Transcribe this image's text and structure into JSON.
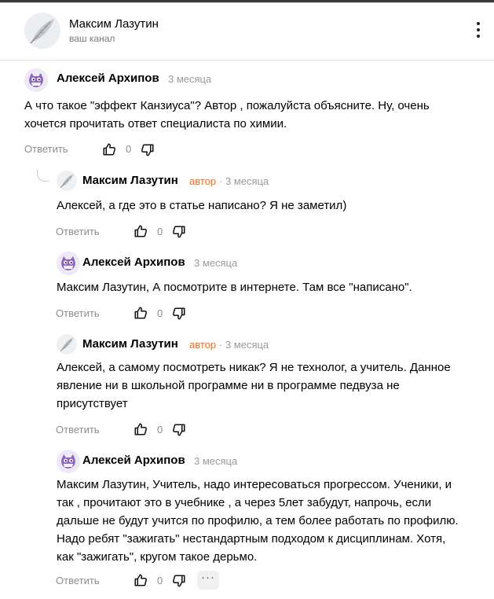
{
  "channel": {
    "name": "Максим Лазутин",
    "subtitle": "ваш канал",
    "avatar_icon": "feather-icon"
  },
  "comments": [
    {
      "author": "Алексей Архипов",
      "date": "3 месяца",
      "text_lines": [
        "А что такое \"эффект Канзиуса\"? Автор , пожалуйста объясните. Ну, очень",
        "хочется прочитать ответ специалиста по химии."
      ],
      "reply_label": "Ответить",
      "likes": "0",
      "avatar_icon": "mascot-avatar-icon"
    },
    {
      "author": "Максим Лазутин",
      "badge": "автор",
      "date": "· 3 месяца",
      "text_lines": [
        "Алексей, а где это в статье написано? Я не заметил)"
      ],
      "reply_label": "Ответить",
      "likes": "0",
      "avatar_icon": "feather-icon"
    },
    {
      "author": "Алексей Архипов",
      "date": "3 месяца",
      "text_lines": [
        "Максим Лазутин, А посмотрите в интернете. Там все \"написано\"."
      ],
      "reply_label": "Ответить",
      "likes": "0",
      "avatar_icon": "mascot-avatar-icon"
    },
    {
      "author": "Максим Лазутин",
      "badge": "автор",
      "date": "· 3 месяца",
      "text_lines": [
        "Алексей, а самому посмотреть никак? Я не технолог, а учитель. Данное",
        "явление ни в школьной программе ни в программе педвуза не",
        "присутствует"
      ],
      "reply_label": "Ответить",
      "likes": "0",
      "avatar_icon": "feather-icon"
    },
    {
      "author": "Алексей Архипов",
      "date": "3 месяца",
      "text_lines": [
        "Максим Лазутин, Учитель, надо интересоваться прогрессом. Ученики, и",
        "так , прочитают это в учебнике , а через 5лет забудут, напрочь, если",
        "дальше не будут учится по профилю, а тем более работать по профилю.",
        "Надо ребят \"зажигать\" нестандартным подходом к дисциплинам. Хотя,",
        "как \"зажигать\", кругом такое дерьмо."
      ],
      "reply_label": "Ответить",
      "likes": "0",
      "more_label": "···",
      "avatar_icon": "mascot-avatar-icon"
    }
  ],
  "colors": {
    "author_badge": "#f26d21",
    "meta_gray": "#9a9a9a",
    "avatar_purple": "#8e63c2"
  }
}
